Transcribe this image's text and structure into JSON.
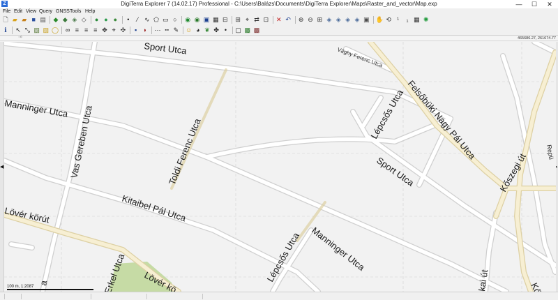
{
  "window": {
    "title": "DigiTerra Explorer 7 (14.02.17) Professional - C:\\Users\\Balázs\\Documents\\DigiTerra Explorer\\Maps\\Raster_and_vector\\Map.exp",
    "controls": {
      "minimize": "—",
      "maximize": "☐",
      "close": "✕"
    }
  },
  "menu": {
    "items": [
      "File",
      "Edit",
      "View",
      "Query",
      "GNSS",
      "Tools",
      "Help"
    ]
  },
  "toolbar": {
    "row1": [
      {
        "icon": "new-document-icon",
        "glyph": "🗋",
        "color": "#333"
      },
      {
        "icon": "open-folder-icon",
        "glyph": "▰",
        "color": "#d8a21b"
      },
      {
        "icon": "open-map-icon",
        "glyph": "▰",
        "color": "#c7811a"
      },
      {
        "icon": "save-icon",
        "glyph": "■",
        "color": "#2b4f9e"
      },
      {
        "icon": "print-icon",
        "glyph": "▤",
        "color": "#555"
      },
      {
        "icon": "layer-icon",
        "glyph": "◆",
        "color": "#2a8a2a"
      },
      {
        "icon": "layer-add-icon",
        "glyph": "◆",
        "color": "#3c7a3c"
      },
      {
        "icon": "layer-edit-icon",
        "glyph": "◈",
        "color": "#4a7a4a"
      },
      {
        "icon": "layer-remove-icon",
        "glyph": "◇",
        "color": "#4a4a4a"
      },
      {
        "icon": "globe-icon",
        "glyph": "●",
        "color": "#2a8a3a"
      },
      {
        "icon": "globe-add-icon",
        "glyph": "●",
        "color": "#2a9a4a"
      },
      {
        "icon": "globe-edit-icon",
        "glyph": "●",
        "color": "#3a8a3a"
      },
      {
        "icon": "draw-point-icon",
        "glyph": "•",
        "color": "#222"
      },
      {
        "icon": "draw-line-icon",
        "glyph": "∕",
        "color": "#222"
      },
      {
        "icon": "draw-curve-icon",
        "glyph": "∿",
        "color": "#222"
      },
      {
        "icon": "draw-polygon-icon",
        "glyph": "⬠",
        "color": "#222"
      },
      {
        "icon": "draw-rectangle-icon",
        "glyph": "▭",
        "color": "#222"
      },
      {
        "icon": "draw-circle-icon",
        "glyph": "○",
        "color": "#222"
      },
      {
        "icon": "go-green-icon",
        "glyph": "◉",
        "color": "#1f8a2f"
      },
      {
        "icon": "stop-icon",
        "glyph": "◉",
        "color": "#2a7a2a"
      },
      {
        "icon": "select-frame-icon",
        "glyph": "▣",
        "color": "#1b3f8f"
      },
      {
        "icon": "node-edit-icon",
        "glyph": "▦",
        "color": "#333"
      },
      {
        "icon": "split-icon",
        "glyph": "⊟",
        "color": "#333"
      },
      {
        "icon": "merge-icon",
        "glyph": "⊞",
        "color": "#333"
      },
      {
        "icon": "snap-icon",
        "glyph": "⌖",
        "color": "#333"
      },
      {
        "icon": "swap-icon",
        "glyph": "⇄",
        "color": "#333"
      },
      {
        "icon": "measure-icon",
        "glyph": "⊡",
        "color": "#333"
      },
      {
        "icon": "delete-icon",
        "glyph": "✕",
        "color": "#c21b1b"
      },
      {
        "icon": "undo-icon",
        "glyph": "↶",
        "color": "#1b3f8f"
      },
      {
        "icon": "zoom-in-icon",
        "glyph": "⊕",
        "color": "#333"
      },
      {
        "icon": "zoom-out-icon",
        "glyph": "⊖",
        "color": "#333"
      },
      {
        "icon": "zoom-window-icon",
        "glyph": "⊞",
        "color": "#333"
      },
      {
        "icon": "zoom-layer-icon",
        "glyph": "◈",
        "color": "#4a6a9a"
      },
      {
        "icon": "zoom-all-icon",
        "glyph": "◈",
        "color": "#4a6a9a"
      },
      {
        "icon": "zoom-prev-icon",
        "glyph": "◈",
        "color": "#4a6a9a"
      },
      {
        "icon": "zoom-next-icon",
        "glyph": "◈",
        "color": "#4a6a9a"
      },
      {
        "icon": "zoom-select-icon",
        "glyph": "▣",
        "color": "#4a4a4a"
      },
      {
        "icon": "pan-hand-icon",
        "glyph": "✋",
        "color": "#333"
      },
      {
        "icon": "rotate-icon",
        "glyph": "⟲",
        "color": "#333"
      },
      {
        "icon": "scale-100-icon",
        "glyph": "¹",
        "color": "#333"
      },
      {
        "icon": "scale-1000-icon",
        "glyph": "₁",
        "color": "#333"
      },
      {
        "icon": "grid-icon",
        "glyph": "▦",
        "color": "#333"
      },
      {
        "icon": "gps-icon",
        "glyph": "✺",
        "color": "#1f9a3a"
      }
    ],
    "row2": [
      {
        "icon": "info-icon",
        "glyph": "ℹ",
        "color": "#1b3f8f"
      },
      {
        "icon": "arrow-select-icon",
        "glyph": "↖",
        "color": "#222"
      },
      {
        "icon": "resize-icon",
        "glyph": "⤡",
        "color": "#222"
      },
      {
        "icon": "image-icon",
        "glyph": "▧",
        "color": "#5a7a3a"
      },
      {
        "icon": "raster-icon",
        "glyph": "▨",
        "color": "#c8a020"
      },
      {
        "icon": "circle-tool-icon",
        "glyph": "◯",
        "color": "#c8a020"
      },
      {
        "icon": "binoculars-icon",
        "glyph": "∞",
        "color": "#111"
      },
      {
        "icon": "align-left-icon",
        "glyph": "≡",
        "color": "#222"
      },
      {
        "icon": "align-center-icon",
        "glyph": "≡",
        "color": "#222"
      },
      {
        "icon": "align-right-icon",
        "glyph": "≡",
        "color": "#222"
      },
      {
        "icon": "move-icon",
        "glyph": "✥",
        "color": "#222"
      },
      {
        "icon": "vertex-icon",
        "glyph": "⌖",
        "color": "#222"
      },
      {
        "icon": "node-icon",
        "glyph": "✣",
        "color": "#222"
      },
      {
        "icon": "attribute-icon",
        "glyph": "▪",
        "color": "#1b3f8f"
      },
      {
        "icon": "shield-icon",
        "glyph": "◗",
        "color": "#9a1b1b"
      },
      {
        "icon": "dotted-line-icon",
        "glyph": "⋯",
        "color": "#222"
      },
      {
        "icon": "dashed-line-icon",
        "glyph": "┅",
        "color": "#222"
      },
      {
        "icon": "pencil-icon",
        "glyph": "✎",
        "color": "#222"
      },
      {
        "icon": "smiley-icon",
        "glyph": "☺",
        "color": "#d8a21b"
      },
      {
        "icon": "stamp-icon",
        "glyph": "◕",
        "color": "#222"
      },
      {
        "icon": "leaf-icon",
        "glyph": "❦",
        "color": "#3a8a3a"
      },
      {
        "icon": "puzzle-icon",
        "glyph": "✤",
        "color": "#222"
      },
      {
        "icon": "bullet-icon",
        "glyph": "•",
        "color": "#222"
      },
      {
        "icon": "frame-icon",
        "glyph": "▢",
        "color": "#222"
      },
      {
        "icon": "photo-icon",
        "glyph": "▩",
        "color": "#2a7a2a"
      },
      {
        "icon": "photo-edit-icon",
        "glyph": "▩",
        "color": "#7a2a2a"
      }
    ]
  },
  "ruler": {
    "mark": "⁻⁰"
  },
  "coordinates": "465686.27, 261674.77",
  "map": {
    "road_color": "#ffffff",
    "road_edge_color": "#cfcfcf",
    "main_road_color": "#f7efd3",
    "main_road_edge": "#ddd0a3",
    "park_color": "#c6dba5",
    "grid_color": "#cfcfcf",
    "labels": [
      {
        "text": "Sport Utca"
      },
      {
        "text": "Vághy Ferenc Utca"
      },
      {
        "text": "Felsőbüki Nagy Pál Utca"
      },
      {
        "text": "Manninger Utca"
      },
      {
        "text": "Lépcsős Utca"
      },
      {
        "text": "Toldi Ferenc Utca"
      },
      {
        "text": "Vas Gereben Utca"
      },
      {
        "text": "Sport Utca"
      },
      {
        "text": "Kőszegi út"
      },
      {
        "text": "Kitaibel Pál Utca"
      },
      {
        "text": "Lövér körút"
      },
      {
        "text": "Manninger Utca"
      },
      {
        "text": "Lépcsős Utca"
      },
      {
        "text": "Lövér kö"
      },
      {
        "text": "Erkel Utca"
      },
      {
        "text": "kai út"
      },
      {
        "text": "Repü"
      },
      {
        "text": "Kő"
      },
      {
        "text": "a"
      }
    ]
  },
  "scale": {
    "label": "100 m, 1:2087"
  }
}
